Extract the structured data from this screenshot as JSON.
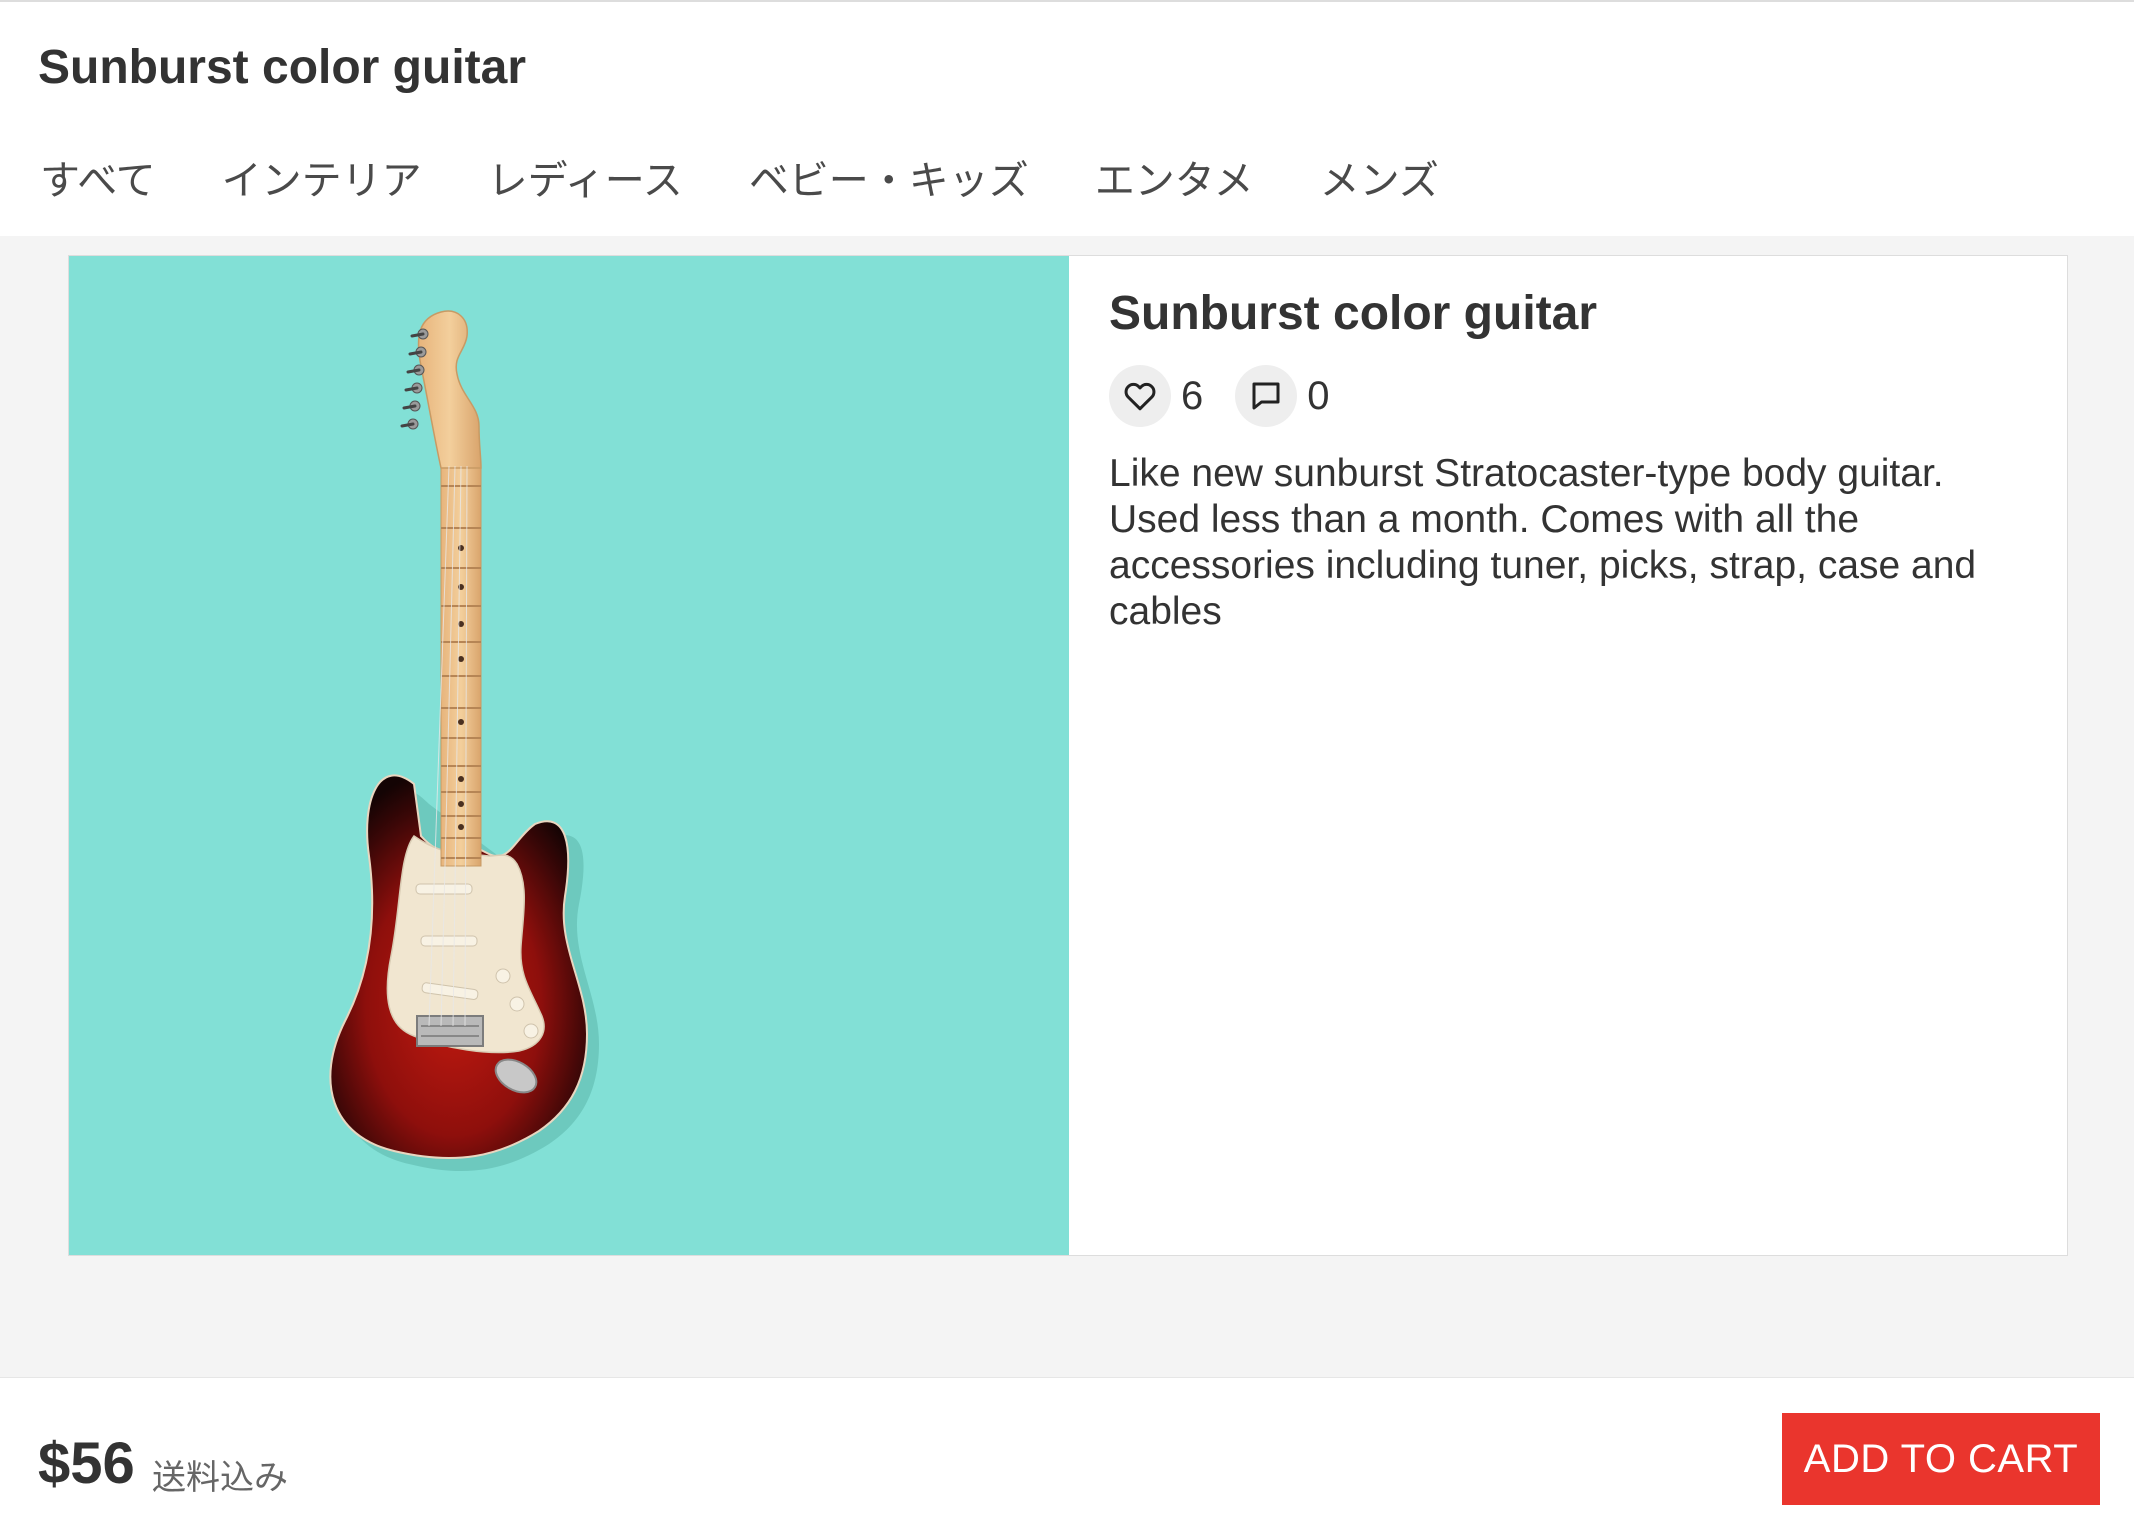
{
  "header": {
    "title": "Sunburst color guitar",
    "nav": [
      "すべて",
      "インテリア",
      "レディース",
      "ベビー・キッズ",
      "エンタメ",
      "メンズ"
    ]
  },
  "product": {
    "title": "Sunburst color guitar",
    "likes": "6",
    "comments": "0",
    "description": "Like new sunburst Stratocaster-type body guitar. Used less than a month. Comes with all the accessories including tuner, picks, strap, case and cables",
    "image_background": "#82e0d6"
  },
  "footer": {
    "price": "$56",
    "shipping_note": "送料込み",
    "cart_button": "ADD TO CART",
    "accent": "#ea352d"
  },
  "icons": {
    "like": "heart-icon",
    "comment": "comment-icon"
  }
}
